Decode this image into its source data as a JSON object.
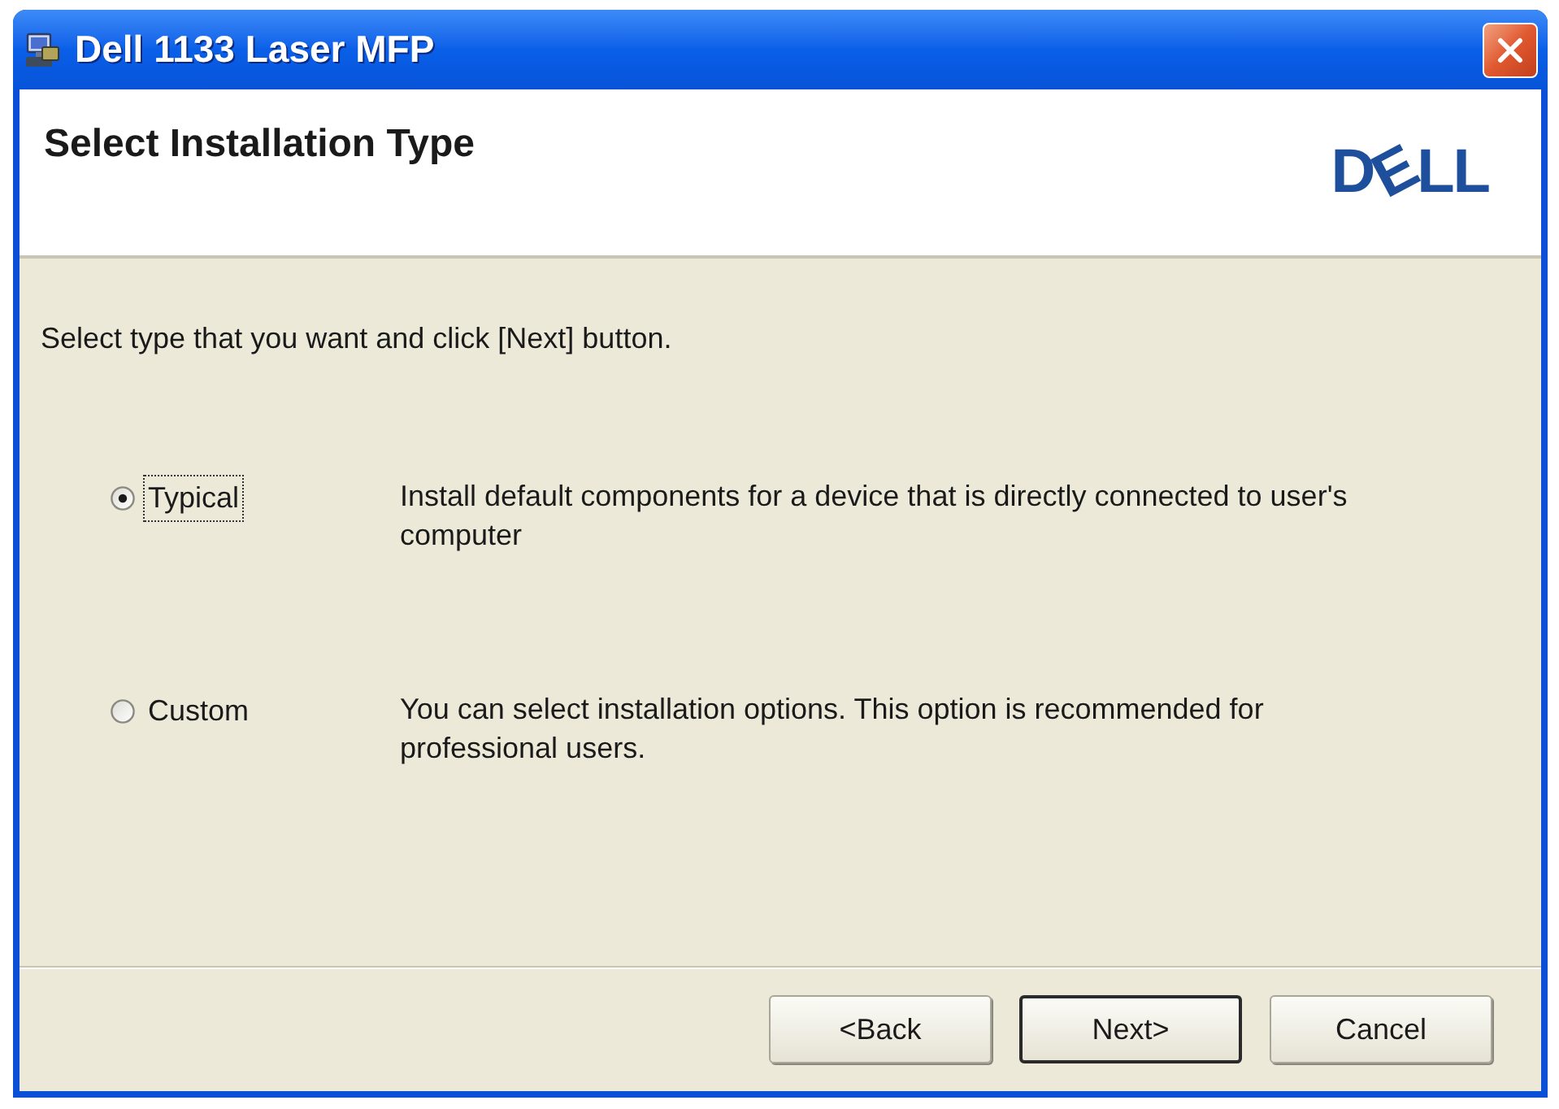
{
  "window": {
    "title": "Dell 1133 Laser MFP"
  },
  "header": {
    "title": "Select Installation Type",
    "logo": "DELL"
  },
  "instruction": "Select type that you want and click [Next] button.",
  "options": [
    {
      "label": "Typical",
      "description": "Install default components for a device that is directly connected to user's computer",
      "selected": true,
      "focused": true
    },
    {
      "label": "Custom",
      "description": "You can select installation options. This option is recommended for professional users.",
      "selected": false,
      "focused": false
    }
  ],
  "buttons": [
    {
      "label": "<Back",
      "default": false
    },
    {
      "label": "Next>",
      "default": true
    },
    {
      "label": "Cancel",
      "default": false
    }
  ]
}
